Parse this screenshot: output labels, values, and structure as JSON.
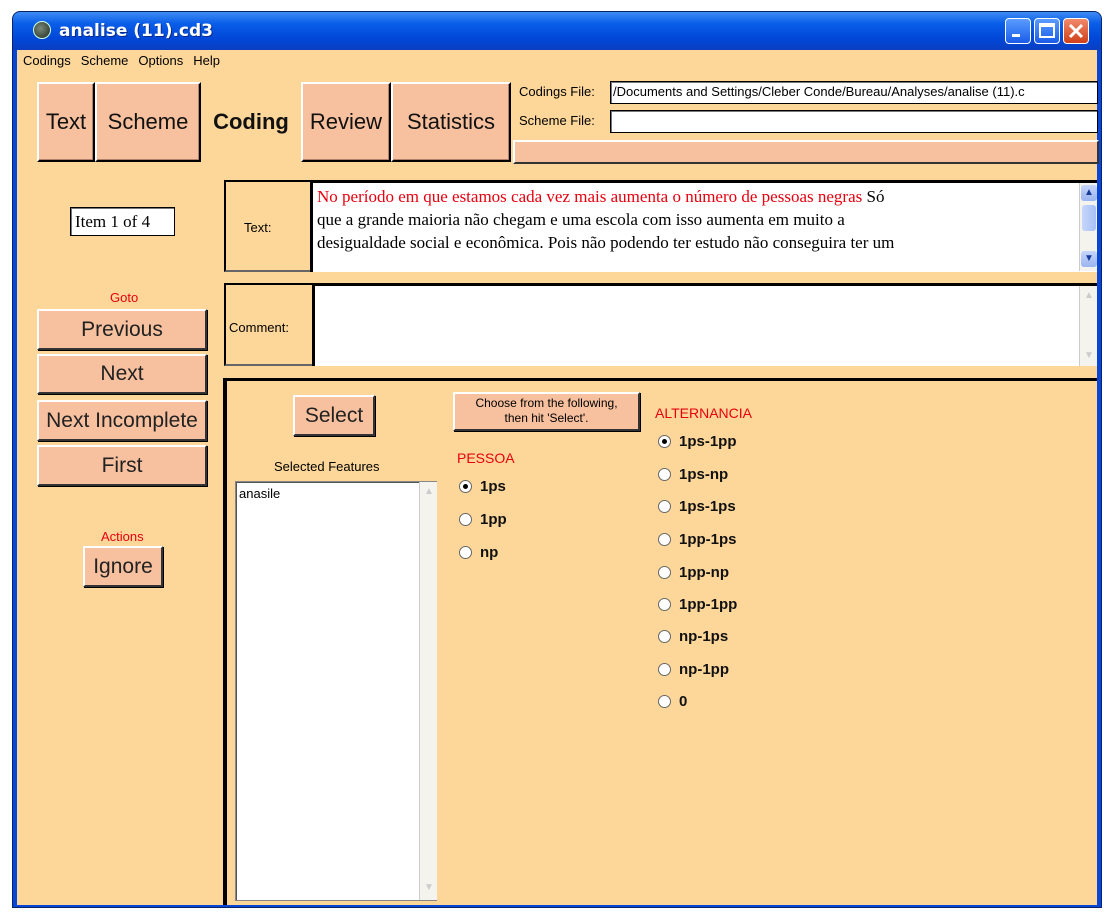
{
  "window": {
    "title": "analise (11).cd3"
  },
  "menu": [
    "Codings",
    "Scheme",
    "Options",
    "Help"
  ],
  "tabs": [
    "Text",
    "Scheme",
    "Coding",
    "Review",
    "Statistics"
  ],
  "files": {
    "codings_label": "Codings File:",
    "codings_value": "/Documents and Settings/Cleber Conde/Bureau/Analyses/analise (11).c",
    "scheme_label": "Scheme File:",
    "scheme_value": ""
  },
  "item_indicator": "Item 1 of 4",
  "goto": {
    "label": "Goto",
    "previous": "Previous",
    "next": "Next",
    "next_incomplete": "Next Incomplete",
    "first": "First"
  },
  "actions": {
    "label": "Actions",
    "ignore": "Ignore"
  },
  "text_panel": {
    "label": "Text:",
    "highlight": "No período em que estamos cada vez mais aumenta o número de pessoas negras",
    "rest_line1": " Só",
    "line2": "que a grande maioria não chegam e uma escola com isso aumenta em muito a",
    "line3": "desigualdade social e econômica. Pois não podendo ter estudo não conseguira ter um"
  },
  "comment_panel": {
    "label": "Comment:",
    "value": ""
  },
  "coding": {
    "select_button": "Select",
    "choose_line1": "Choose from the following,",
    "choose_line2": "then hit 'Select'.",
    "selected_features_label": "Selected Features",
    "selected_features": [
      "anasile"
    ],
    "pessoa": {
      "title": "PESSOA",
      "options": [
        "1ps",
        "1pp",
        "np"
      ],
      "selected": "1ps"
    },
    "alternancia": {
      "title": "ALTERNANCIA",
      "options": [
        "1ps-1pp",
        "1ps-np",
        "1ps-1ps",
        "1pp-1ps",
        "1pp-np",
        "1pp-1pp",
        "np-1ps",
        "np-1pp",
        "0"
      ],
      "selected": "1ps-1pp"
    }
  },
  "colors": {
    "background": "#fdd79a",
    "button": "#f7c09e",
    "accent_red": "#e8000e",
    "titlebar": "#0a5ee8"
  }
}
